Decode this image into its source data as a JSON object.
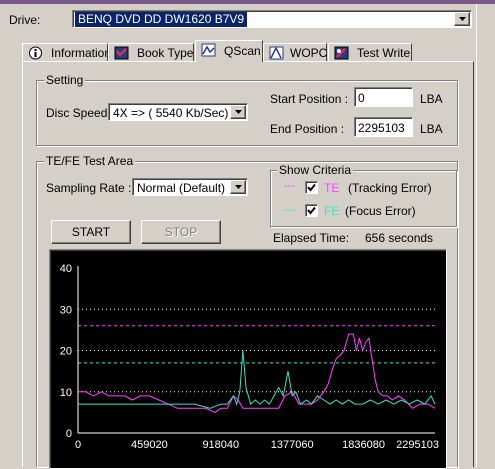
{
  "drive": {
    "label": "Drive:",
    "value": "BENQ     DVD DD DW1620   B7V9"
  },
  "tabs": [
    {
      "label": "Information",
      "icon": "info-icon"
    },
    {
      "label": "Book Type",
      "icon": "book-type-icon"
    },
    {
      "label": "QScan",
      "icon": "qscan-icon",
      "active": true
    },
    {
      "label": "WOPC",
      "icon": "wopc-icon"
    },
    {
      "label": "Test Write",
      "icon": "test-write-icon"
    }
  ],
  "setting": {
    "title": "Setting",
    "disc_speed_label": "Disc Speed:",
    "disc_speed_value": "4X => ( 5540 Kb/Sec)",
    "start_label": "Start Position :",
    "start_value": "0",
    "end_label": "End Position :",
    "end_value": "2295103",
    "lba": "LBA"
  },
  "test_area": {
    "title": "TE/FE Test Area",
    "sampling_label": "Sampling Rate :",
    "sampling_value": "Normal (Default)",
    "show_criteria": "Show Criteria",
    "te_dash": "---",
    "te_code": "TE",
    "te_desc": "(Tracking Error)",
    "fe_dash": "---",
    "fe_code": "FE",
    "fe_desc": "(Focus Error)",
    "start_button": "START",
    "stop_button": "STOP",
    "elapsed_label": "Elapsed Time:",
    "elapsed_value": "656 seconds"
  },
  "colors": {
    "te": "#ff44ff",
    "fe": "#40e0c0",
    "te_threshold": "#ff44ff",
    "fe_threshold": "#40e0c0",
    "grid": "#ffffff"
  },
  "chart_data": {
    "type": "line",
    "ylim": [
      0,
      40
    ],
    "xlim": [
      0,
      2295103
    ],
    "y_ticks": [
      "40",
      "30",
      "20",
      "10",
      "0"
    ],
    "x_ticks": [
      "0",
      "459020",
      "918040",
      "1377060",
      "1836080",
      "2295103"
    ],
    "grid_lines": [
      30,
      20,
      10
    ],
    "thresholds": {
      "te": 26,
      "fe": 17
    },
    "series": [
      {
        "name": "TE",
        "values": [
          [
            0,
            10
          ],
          [
            50000,
            10
          ],
          [
            100000,
            9
          ],
          [
            150000,
            10
          ],
          [
            200000,
            9
          ],
          [
            250000,
            9
          ],
          [
            300000,
            9
          ],
          [
            350000,
            8
          ],
          [
            400000,
            9
          ],
          [
            459020,
            9
          ],
          [
            520000,
            8
          ],
          [
            580000,
            7
          ],
          [
            640000,
            6
          ],
          [
            700000,
            6
          ],
          [
            760000,
            6
          ],
          [
            820000,
            6
          ],
          [
            880000,
            5
          ],
          [
            918040,
            6
          ],
          [
            960000,
            6
          ],
          [
            1000000,
            9
          ],
          [
            1030000,
            8
          ],
          [
            1060000,
            6
          ],
          [
            1100000,
            6
          ],
          [
            1140000,
            6
          ],
          [
            1180000,
            6
          ],
          [
            1210000,
            6
          ],
          [
            1250000,
            6
          ],
          [
            1290000,
            6
          ],
          [
            1330000,
            9
          ],
          [
            1377060,
            10
          ],
          [
            1420000,
            7
          ],
          [
            1460000,
            7
          ],
          [
            1500000,
            7
          ],
          [
            1540000,
            8
          ],
          [
            1580000,
            10
          ],
          [
            1610000,
            12
          ],
          [
            1640000,
            16
          ],
          [
            1660000,
            18
          ],
          [
            1690000,
            19
          ],
          [
            1710000,
            20
          ],
          [
            1740000,
            24
          ],
          [
            1770000,
            24
          ],
          [
            1790000,
            20
          ],
          [
            1810000,
            23
          ],
          [
            1830000,
            20
          ],
          [
            1850000,
            22
          ],
          [
            1870000,
            23
          ],
          [
            1890000,
            18
          ],
          [
            1910000,
            13
          ],
          [
            1930000,
            10
          ],
          [
            1960000,
            9
          ],
          [
            1990000,
            9
          ],
          [
            2020000,
            8
          ],
          [
            2060000,
            9
          ],
          [
            2100000,
            8
          ],
          [
            2150000,
            6
          ],
          [
            2200000,
            7
          ],
          [
            2250000,
            7
          ],
          [
            2295103,
            6
          ]
        ]
      },
      {
        "name": "FE",
        "values": [
          [
            0,
            7
          ],
          [
            100000,
            7
          ],
          [
            200000,
            7
          ],
          [
            300000,
            7
          ],
          [
            400000,
            7
          ],
          [
            459020,
            7
          ],
          [
            550000,
            7
          ],
          [
            650000,
            7
          ],
          [
            750000,
            7
          ],
          [
            850000,
            6
          ],
          [
            918040,
            7
          ],
          [
            960000,
            7
          ],
          [
            1000000,
            9
          ],
          [
            1020000,
            7
          ],
          [
            1040000,
            10
          ],
          [
            1060000,
            20
          ],
          [
            1080000,
            11
          ],
          [
            1110000,
            7
          ],
          [
            1140000,
            8
          ],
          [
            1170000,
            7
          ],
          [
            1200000,
            8
          ],
          [
            1230000,
            7
          ],
          [
            1260000,
            9
          ],
          [
            1290000,
            11
          ],
          [
            1320000,
            9
          ],
          [
            1350000,
            15
          ],
          [
            1377060,
            9
          ],
          [
            1400000,
            10
          ],
          [
            1430000,
            7
          ],
          [
            1470000,
            8
          ],
          [
            1500000,
            7
          ],
          [
            1540000,
            9
          ],
          [
            1580000,
            8
          ],
          [
            1620000,
            7
          ],
          [
            1660000,
            8
          ],
          [
            1700000,
            7
          ],
          [
            1740000,
            8
          ],
          [
            1780000,
            7
          ],
          [
            1830000,
            7
          ],
          [
            1880000,
            8
          ],
          [
            1930000,
            7
          ],
          [
            1980000,
            8
          ],
          [
            2030000,
            7
          ],
          [
            2080000,
            8
          ],
          [
            2130000,
            7
          ],
          [
            2180000,
            8
          ],
          [
            2230000,
            7
          ],
          [
            2270000,
            9
          ],
          [
            2295103,
            7
          ]
        ]
      }
    ]
  }
}
